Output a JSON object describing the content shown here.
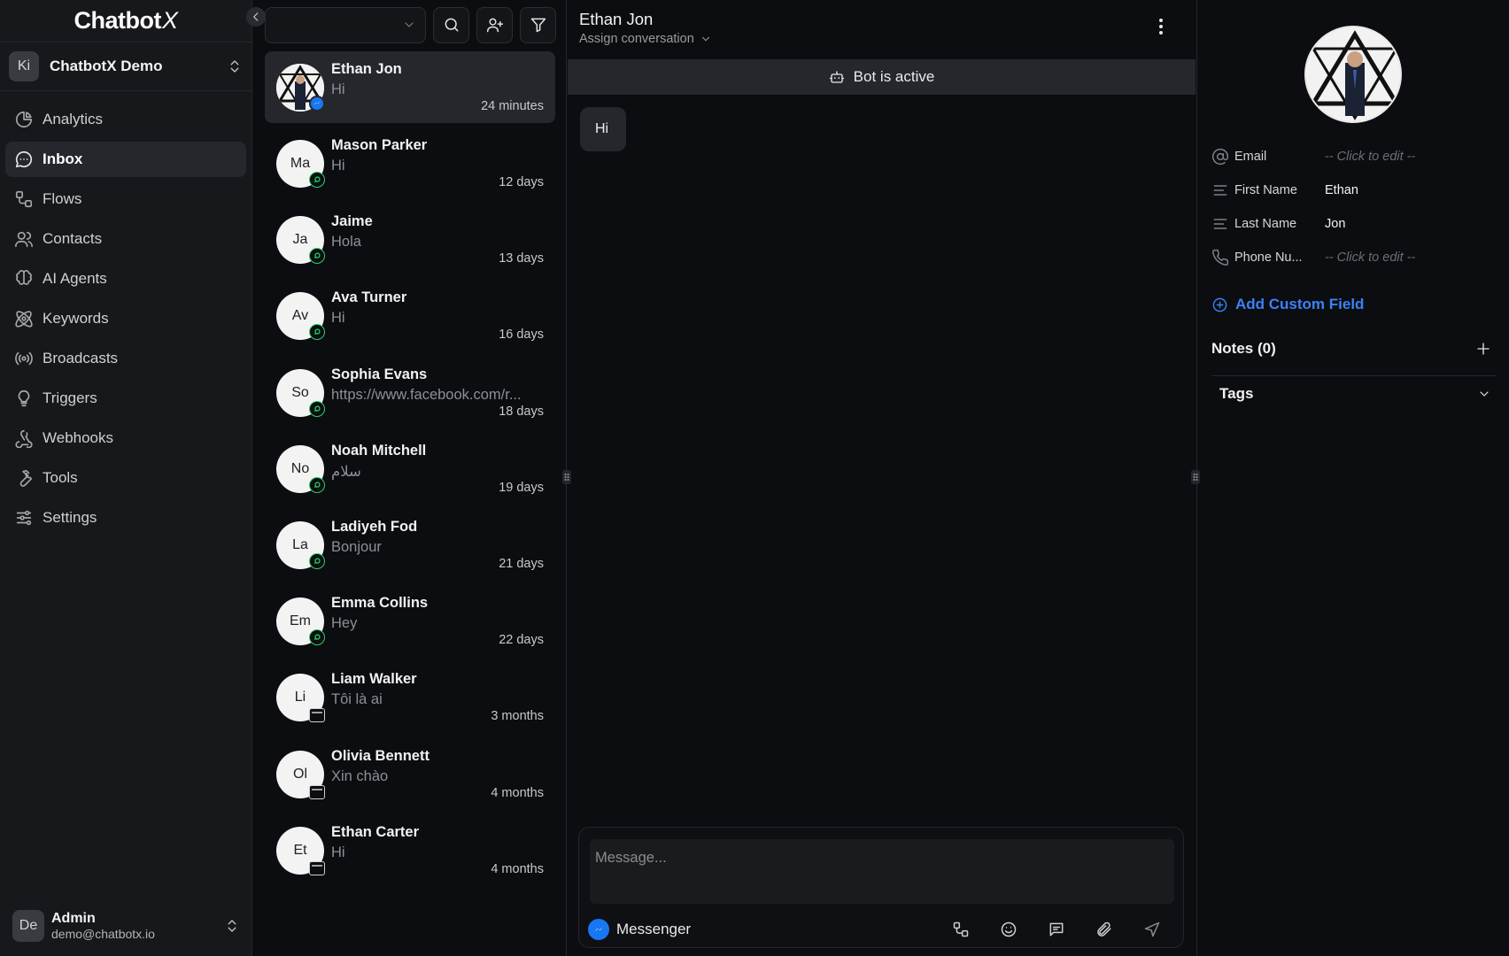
{
  "brand": {
    "name": "Chatbot",
    "suffix": "X"
  },
  "workspace": {
    "initials": "Ki",
    "name": "ChatbotX Demo"
  },
  "nav": [
    {
      "label": "Analytics",
      "icon": "pie-chart-icon",
      "active": false
    },
    {
      "label": "Inbox",
      "icon": "message-circle-icon",
      "active": true
    },
    {
      "label": "Flows",
      "icon": "flows-icon",
      "active": false
    },
    {
      "label": "Contacts",
      "icon": "users-icon",
      "active": false
    },
    {
      "label": "AI Agents",
      "icon": "brain-icon",
      "active": false
    },
    {
      "label": "Keywords",
      "icon": "keywords-icon",
      "active": false
    },
    {
      "label": "Broadcasts",
      "icon": "broadcast-icon",
      "active": false
    },
    {
      "label": "Triggers",
      "icon": "lightbulb-icon",
      "active": false
    },
    {
      "label": "Webhooks",
      "icon": "webhook-icon",
      "active": false
    },
    {
      "label": "Tools",
      "icon": "wrench-icon",
      "active": false
    },
    {
      "label": "Settings",
      "icon": "sliders-icon",
      "active": false
    }
  ],
  "user": {
    "initials": "De",
    "name": "Admin",
    "email": "demo@chatbotx.io"
  },
  "conversations": [
    {
      "name": "Ethan Jon",
      "preview": "Hi",
      "time": "24 minutes",
      "initials": "",
      "channel": "messenger",
      "active": true,
      "photo": true
    },
    {
      "name": "Mason Parker",
      "preview": "Hi",
      "time": "12 days",
      "initials": "Ma",
      "channel": "whatsapp"
    },
    {
      "name": "Jaime",
      "preview": "Hola",
      "time": "13 days",
      "initials": "Ja",
      "channel": "whatsapp"
    },
    {
      "name": "Ava Turner",
      "preview": "Hi",
      "time": "16 days",
      "initials": "Av",
      "channel": "whatsapp"
    },
    {
      "name": "Sophia Evans",
      "preview": "https://www.facebook.com/r...",
      "time": "18 days",
      "initials": "So",
      "channel": "whatsapp"
    },
    {
      "name": "Noah Mitchell",
      "preview": "سلام",
      "time": "19 days",
      "initials": "No",
      "channel": "whatsapp"
    },
    {
      "name": "Ladiyeh Fod",
      "preview": "Bonjour",
      "time": "21 days",
      "initials": "La",
      "channel": "whatsapp"
    },
    {
      "name": "Emma Collins",
      "preview": "Hey",
      "time": "22 days",
      "initials": "Em",
      "channel": "whatsapp"
    },
    {
      "name": "Liam Walker",
      "preview": "Tôi là ai",
      "time": "3 months",
      "initials": "Li",
      "channel": "web"
    },
    {
      "name": "Olivia Bennett",
      "preview": "Xin chào",
      "time": "4 months",
      "initials": "Ol",
      "channel": "web"
    },
    {
      "name": "Ethan Carter",
      "preview": "Hi",
      "time": "4 months",
      "initials": "Et",
      "channel": "web"
    }
  ],
  "chat": {
    "title": "Ethan Jon",
    "assign_label": "Assign conversation",
    "bot_status": "Bot is active",
    "messages": [
      {
        "text": "Hi",
        "from": "contact"
      }
    ],
    "composer_placeholder": "Message...",
    "channel_label": "Messenger"
  },
  "details": {
    "fields": [
      {
        "label": "Email",
        "value": "-- Click to edit --",
        "empty": true,
        "icon": "at-sign-icon"
      },
      {
        "label": "First Name",
        "value": "Ethan",
        "empty": false,
        "icon": "text-lines-icon"
      },
      {
        "label": "Last Name",
        "value": "Jon",
        "empty": false,
        "icon": "text-lines-icon"
      },
      {
        "label": "Phone Nu...",
        "value": "-- Click to edit --",
        "empty": true,
        "icon": "phone-icon"
      }
    ],
    "add_field_label": "Add Custom Field",
    "notes_label": "Notes (0)",
    "tags_label": "Tags"
  },
  "colors": {
    "accent": "#3b82f6",
    "whatsapp": "#25d366",
    "messenger": "#1877f2",
    "active_bg": "#26272c"
  }
}
